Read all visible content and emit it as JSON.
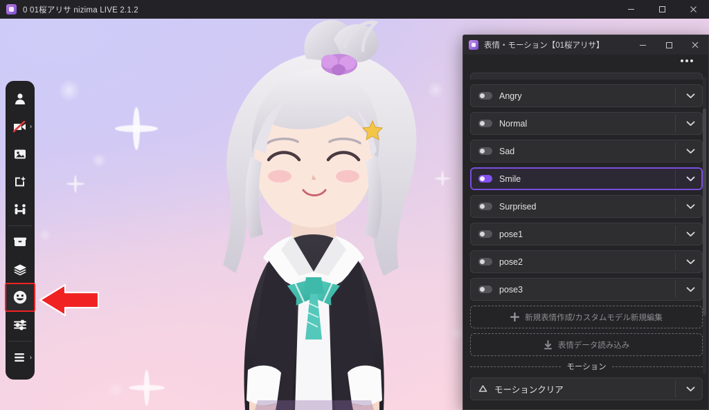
{
  "window": {
    "title": "0 01桜アリサ nizima LIVE 2.1.2",
    "app_icon": "app-logo-icon",
    "controls": {
      "minimize": "minimize-icon",
      "maximize": "maximize-icon",
      "close": "close-icon"
    }
  },
  "sidebar": {
    "items": [
      {
        "name": "model-icon",
        "label": "Model",
        "selected": false,
        "has_arrow": false
      },
      {
        "name": "camera-off-icon",
        "label": "Camera Off",
        "selected": false,
        "has_arrow": true
      },
      {
        "name": "background-image-icon",
        "label": "Background",
        "selected": false,
        "has_arrow": false
      },
      {
        "name": "add-effect-icon",
        "label": "Add Effect",
        "selected": false,
        "has_arrow": false
      },
      {
        "name": "motion-capture-icon",
        "label": "Tracking",
        "selected": false,
        "has_arrow": false
      },
      {
        "name": "archive-box-icon",
        "label": "Items",
        "selected": false,
        "has_arrow": false
      },
      {
        "name": "layers-icon",
        "label": "Layers",
        "selected": false,
        "has_arrow": false
      },
      {
        "name": "expression-face-icon",
        "label": "Expressions",
        "selected": true,
        "has_arrow": false
      },
      {
        "name": "sliders-icon",
        "label": "Settings",
        "selected": false,
        "has_arrow": false
      },
      {
        "name": "menu-icon",
        "label": "Menu",
        "selected": false,
        "has_arrow": true
      }
    ],
    "accent_selected": "#f02222"
  },
  "annotation": {
    "arrow": "red-left-arrow",
    "color": "#f02222"
  },
  "panel": {
    "title": "表情・モーション【01桜アリサ】",
    "icon": "panel-logo-icon",
    "controls": {
      "minimize": "minimize-icon",
      "maximize": "maximize-icon",
      "close": "close-icon"
    },
    "overflow_menu": "kebab-menu-icon",
    "accent": "#7b4fe0",
    "expressions": [
      {
        "label": "Angry",
        "active": false
      },
      {
        "label": "Normal",
        "active": false
      },
      {
        "label": "Sad",
        "active": false
      },
      {
        "label": "Smile",
        "active": true
      },
      {
        "label": "Surprised",
        "active": false
      },
      {
        "label": "pose1",
        "active": false
      },
      {
        "label": "pose2",
        "active": false
      },
      {
        "label": "pose3",
        "active": false
      }
    ],
    "actions": [
      {
        "icon": "plus-icon",
        "label": "新規表情作成/カスタムモデル新規編集"
      },
      {
        "icon": "download-icon",
        "label": "表情データ読み込み"
      }
    ],
    "motion_section": {
      "title": "モーション",
      "first_item": "モーションクリア"
    }
  }
}
